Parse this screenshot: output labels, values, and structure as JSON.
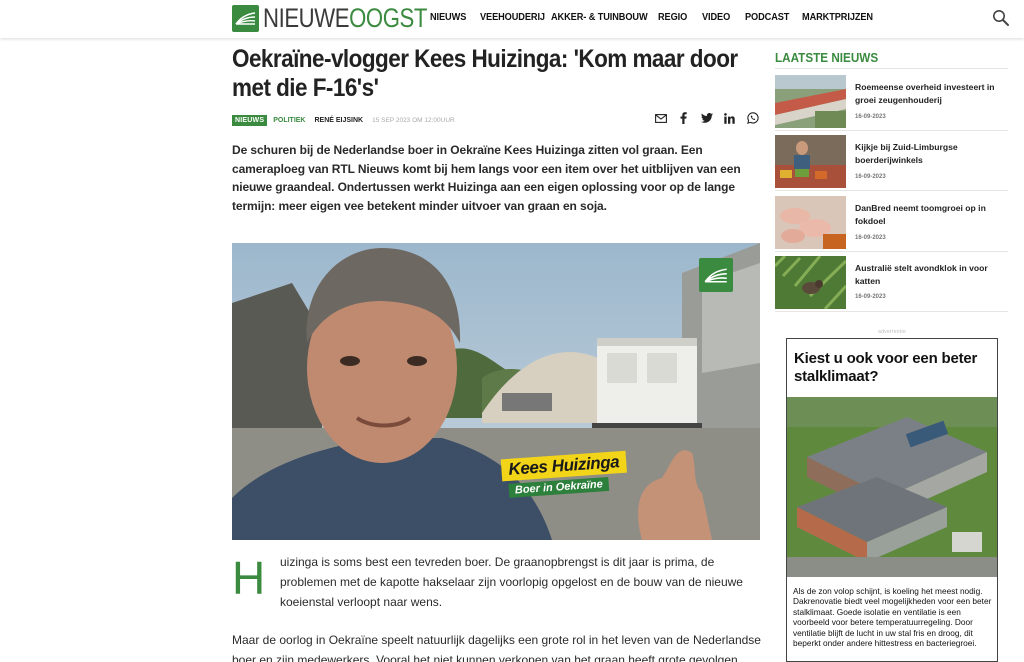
{
  "brand": {
    "name_part1": "NIEUWE",
    "name_part2": "OOGST",
    "accent": "#3a8a3f"
  },
  "nav": {
    "items": [
      "NIEUWS",
      "VEEHOUDERIJ",
      "AKKER- & TUINBOUW",
      "REGIO",
      "VIDEO",
      "PODCAST",
      "MARKTPRIJZEN"
    ],
    "search_icon": "search-icon"
  },
  "article": {
    "title": "Oekraïne-vlogger Kees Huizinga: 'Kom maar door met die F-16's'",
    "category_tag": "NIEUWS",
    "subcategory": "POLITIEK",
    "author": "RENÉ EIJSINK",
    "date": "15 SEP 2023 OM 12:00UUR",
    "share_icons": [
      "mail-icon",
      "facebook-icon",
      "twitter-icon",
      "linkedin-icon",
      "whatsapp-icon"
    ],
    "lead": "De schuren bij de Nederlandse boer in Oekraïne Kees Huizinga zitten vol graan. Een cameraploeg van RTL Nieuws komt bij hem langs voor een item over het uitblijven van een nieuwe graandeal. Ondertussen werkt Huizinga aan een eigen oplossing voor op de lange termijn: meer eigen vee betekent minder uitvoer van graan en soja.",
    "video": {
      "name": "Kees Huizinga",
      "subtitle": "Boer in Oekraïne"
    },
    "dropcap": "H",
    "paragraph1": "uizinga is soms best een tevreden boer. De graanopbrengst is dit jaar is prima, de problemen met de kapotte hakselaar zijn voorlopig opgelost en de bouw van de nieuwe koeienstal verloopt naar wens.",
    "paragraph2": "Maar de oorlog in Oekraïne speelt natuurlijk dagelijks een grote rol in het leven van de Nederlandse boer en zijn medewerkers. Vooral het niet kunnen verkopen van het graan heeft grote gevolgen."
  },
  "sidebar": {
    "title": "LAATSTE NIEUWS",
    "items": [
      {
        "title": "Roemeense overheid investeert in groei zeugenhouderij",
        "date": "16-09-2023"
      },
      {
        "title": "Kijkje bij Zuid-Limburgse boerderijwinkels",
        "date": "16-09-2023"
      },
      {
        "title": "DanBred neemt toomgroei op in fokdoel",
        "date": "16-09-2023"
      },
      {
        "title": "Australië stelt avondklok in voor katten",
        "date": "16-09-2023"
      }
    ],
    "ad_label": "advertentie",
    "ad": {
      "headline": "Kiest u ook voor een beter stalklimaat?",
      "text": "Als de zon volop schijnt, is koeling het meest nodig. Dakrenovatie biedt veel mogelijkheden voor een beter stalklimaat. Goede isolatie en ventilatie is een voorbeeld voor betere temperatuurregeling. Door ventilatie blijft de lucht in uw stal fris en droog, dit beperkt onder andere hittestress en bacteriegroei."
    }
  }
}
